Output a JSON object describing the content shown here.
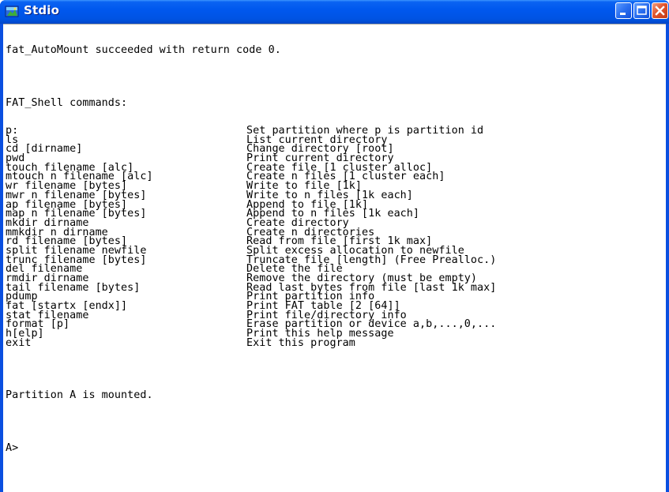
{
  "window": {
    "title": "Stdio",
    "icon": "console-app-icon",
    "buttons": [
      "minimize",
      "maximize",
      "close"
    ]
  },
  "console": {
    "status_line": "fat_AutoMount succeeded with return code 0.",
    "header": "FAT_Shell commands:",
    "commands": [
      {
        "cmd": "p:",
        "desc": "Set partition where p is partition id"
      },
      {
        "cmd": "ls",
        "desc": "List current directory"
      },
      {
        "cmd": "cd [dirname]",
        "desc": "Change directory [root]"
      },
      {
        "cmd": "pwd",
        "desc": "Print current directory"
      },
      {
        "cmd": "touch filename [alc]",
        "desc": "Create file [1 cluster alloc]"
      },
      {
        "cmd": "mtouch n filename [alc]",
        "desc": "Create n files [1 cluster each]"
      },
      {
        "cmd": "wr filename [bytes]",
        "desc": "Write to file [1k]"
      },
      {
        "cmd": "mwr n filename [bytes]",
        "desc": "Write to n files [1k each]"
      },
      {
        "cmd": "ap filename [bytes]",
        "desc": "Append to file [1k]"
      },
      {
        "cmd": "map n filename [bytes]",
        "desc": "Append to n files [1k each]"
      },
      {
        "cmd": "mkdir dirname",
        "desc": "Create directory"
      },
      {
        "cmd": "mmkdir n dirname",
        "desc": "Create n directories"
      },
      {
        "cmd": "rd filename [bytes]",
        "desc": "Read from file [first 1k max]"
      },
      {
        "cmd": "split filename newfile",
        "desc": "Split excess allocation to newfile"
      },
      {
        "cmd": "trunc filename [bytes]",
        "desc": "Truncate file [length] (Free Prealloc.)"
      },
      {
        "cmd": "del filename",
        "desc": "Delete the file"
      },
      {
        "cmd": "rmdir dirname",
        "desc": "Remove the directory (must be empty)"
      },
      {
        "cmd": "tail filename [bytes]",
        "desc": "Read last bytes from file [last 1k max]"
      },
      {
        "cmd": "pdump",
        "desc": "Print partition info"
      },
      {
        "cmd": "fat [startx [endx]]",
        "desc": "Print FAT table [2 [64]]"
      },
      {
        "cmd": "stat filename",
        "desc": "Print file/directory info"
      },
      {
        "cmd": "format [p]",
        "desc": "Erase partition or device a,b,...,0,..."
      },
      {
        "cmd": "h[elp]",
        "desc": "Print this help message"
      },
      {
        "cmd": "exit",
        "desc": "Exit this program"
      }
    ],
    "mount_message": "Partition A is mounted.",
    "prompt": "A>"
  },
  "colors": {
    "titlebar": "#0058ee",
    "close_button": "#e0542c",
    "console_bg": "#ffffff",
    "console_text": "#000000"
  }
}
